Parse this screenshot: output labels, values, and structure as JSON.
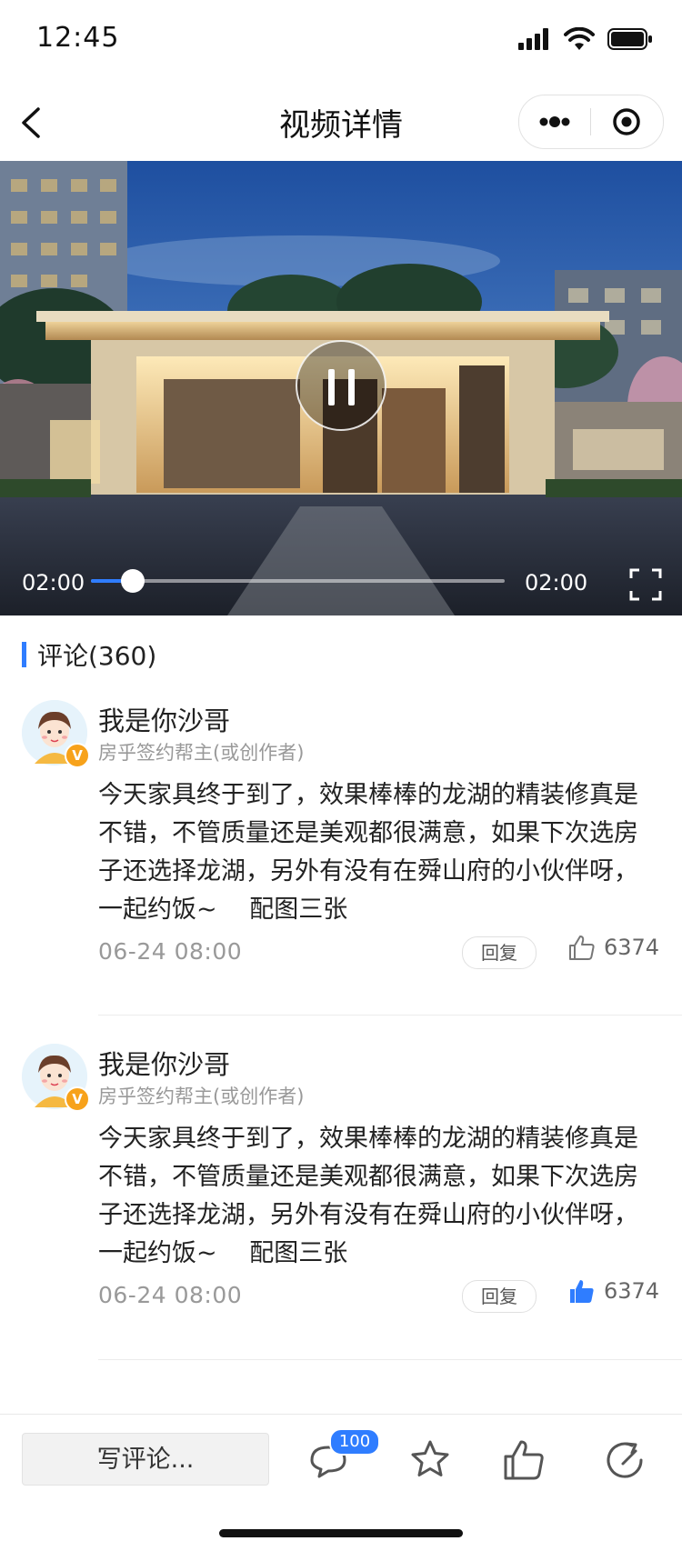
{
  "status_bar": {
    "time": "12:45"
  },
  "nav": {
    "title": "视频详情"
  },
  "video": {
    "current_time": "02:00",
    "duration": "02:00",
    "progress": 0.1
  },
  "comments_section": {
    "header": "评论(360)",
    "items": [
      {
        "name": "我是你沙哥",
        "role": "房乎签约帮主(或创作者)",
        "body": "今天家具终于到了，效果棒棒的龙湖的精装修真是不错，不管质量还是美观都很满意，如果下次选房子还选择龙湖，另外有没有在舜山府的小伙伴呀，一起约饭~　 配图三张",
        "time": "06-24   08:00",
        "reply_label": "回复",
        "likes": "6374",
        "liked": false,
        "verified_badge": "V"
      },
      {
        "name": "我是你沙哥",
        "role": "房乎签约帮主(或创作者)",
        "body": "今天家具终于到了，效果棒棒的龙湖的精装修真是不错，不管质量还是美观都很满意，如果下次选房子还选择龙湖，另外有没有在舜山府的小伙伴呀，一起约饭~　 配图三张",
        "time": "06-24   08:00",
        "reply_label": "回复",
        "likes": "6374",
        "liked": true,
        "verified_badge": "V"
      }
    ]
  },
  "bottom_bar": {
    "write_comment": "写评论...",
    "comment_count_badge": "100",
    "icons": [
      "comment-icon",
      "star-icon",
      "thumbs-up-icon",
      "share-icon"
    ]
  },
  "colors": {
    "accent": "#2f7dff",
    "badge_orange": "#f7a21b"
  }
}
